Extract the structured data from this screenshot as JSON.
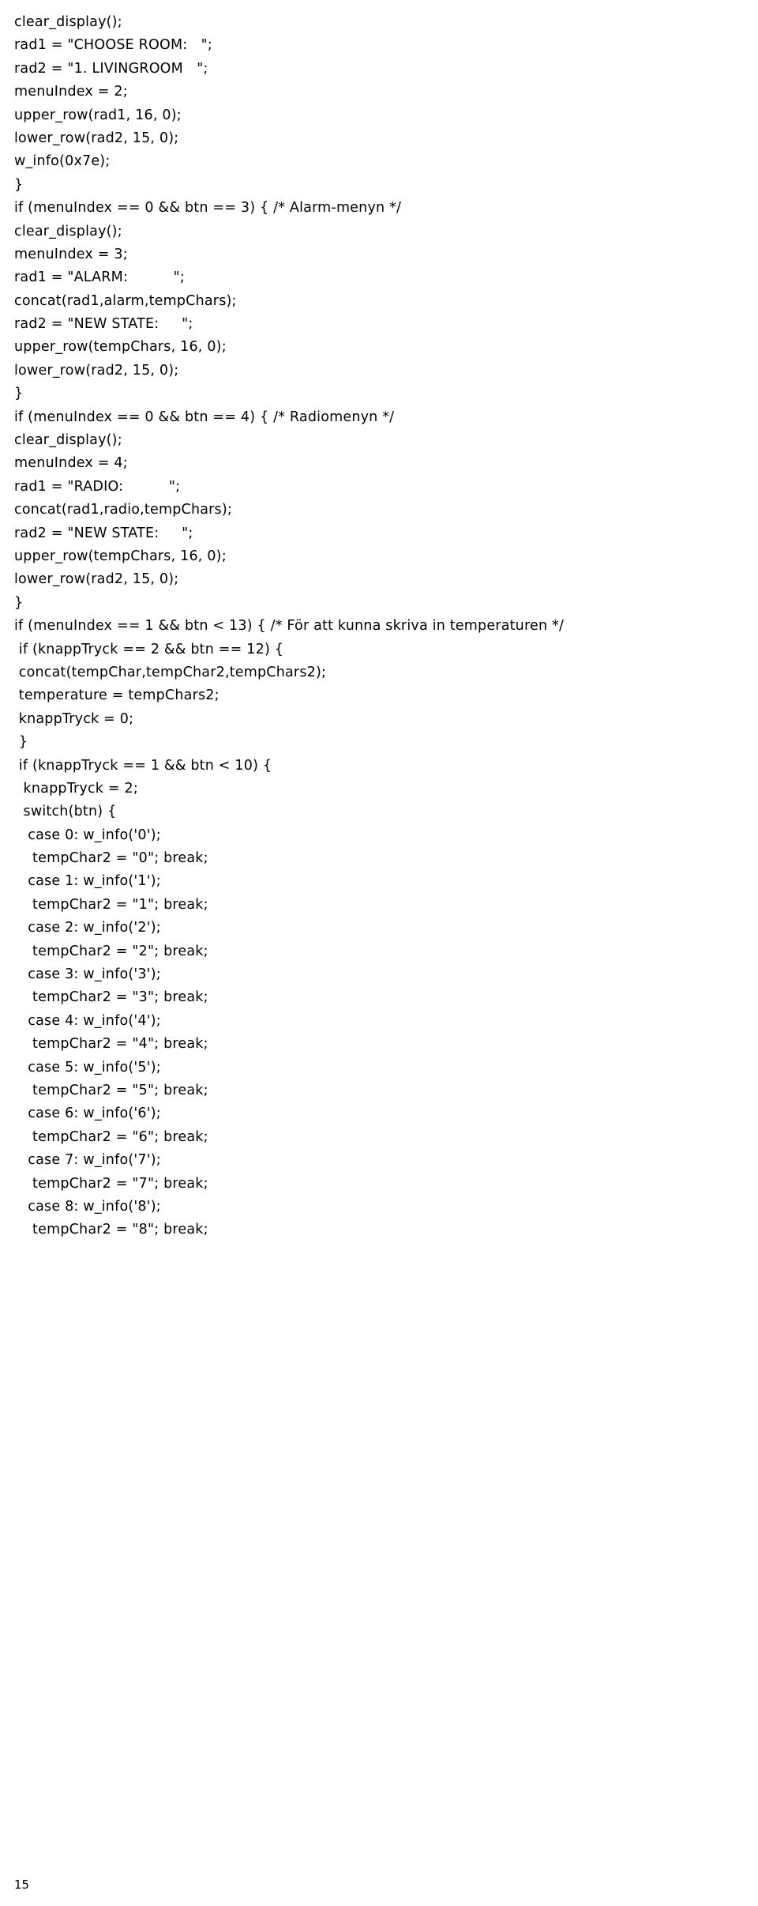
{
  "lines": [
    "clear_display();",
    "rad1 = \"CHOOSE ROOM:   \";",
    "rad2 = \"1. LIVINGROOM   \";",
    "menuIndex = 2;",
    "upper_row(rad1, 16, 0);",
    "lower_row(rad2, 15, 0);",
    "w_info(0x7e);",
    "}",
    "",
    "if (menuIndex == 0 && btn == 3) { /* Alarm-menyn */",
    "clear_display();",
    "menuIndex = 3;",
    "rad1 = \"ALARM:          \";",
    "concat(rad1,alarm,tempChars);",
    "rad2 = \"NEW STATE:     \";",
    "upper_row(tempChars, 16, 0);",
    "lower_row(rad2, 15, 0);",
    "",
    "}",
    "",
    "if (menuIndex == 0 && btn == 4) { /* Radiomenyn */",
    "clear_display();",
    "menuIndex = 4;",
    "rad1 = \"RADIO:          \";",
    "concat(rad1,radio,tempChars);",
    "rad2 = \"NEW STATE:     \";",
    "upper_row(tempChars, 16, 0);",
    "lower_row(rad2, 15, 0);",
    "}",
    "if (menuIndex == 1 && btn < 13) { /* För att kunna skriva in temperaturen */",
    " if (knappTryck == 2 && btn == 12) {",
    " concat(tempChar,tempChar2,tempChars2);",
    " temperature = tempChars2;",
    " knappTryck = 0;",
    " }",
    " if (knappTryck == 1 && btn < 10) {",
    "  knappTryck = 2;",
    "  switch(btn) {",
    "   case 0: w_info('0');",
    "    tempChar2 = \"0\"; break;",
    "   case 1: w_info('1');",
    "    tempChar2 = \"1\"; break;",
    "   case 2: w_info('2');",
    "    tempChar2 = \"2\"; break;",
    "   case 3: w_info('3');",
    "    tempChar2 = \"3\"; break;",
    "   case 4: w_info('4');",
    "    tempChar2 = \"4\"; break;",
    "   case 5: w_info('5');",
    "    tempChar2 = \"5\"; break;",
    "   case 6: w_info('6');",
    "    tempChar2 = \"6\"; break;",
    "   case 7: w_info('7');",
    "    tempChar2 = \"7\"; break;",
    "   case 8: w_info('8');",
    "    tempChar2 = \"8\"; break;"
  ],
  "pageNumber": "15"
}
